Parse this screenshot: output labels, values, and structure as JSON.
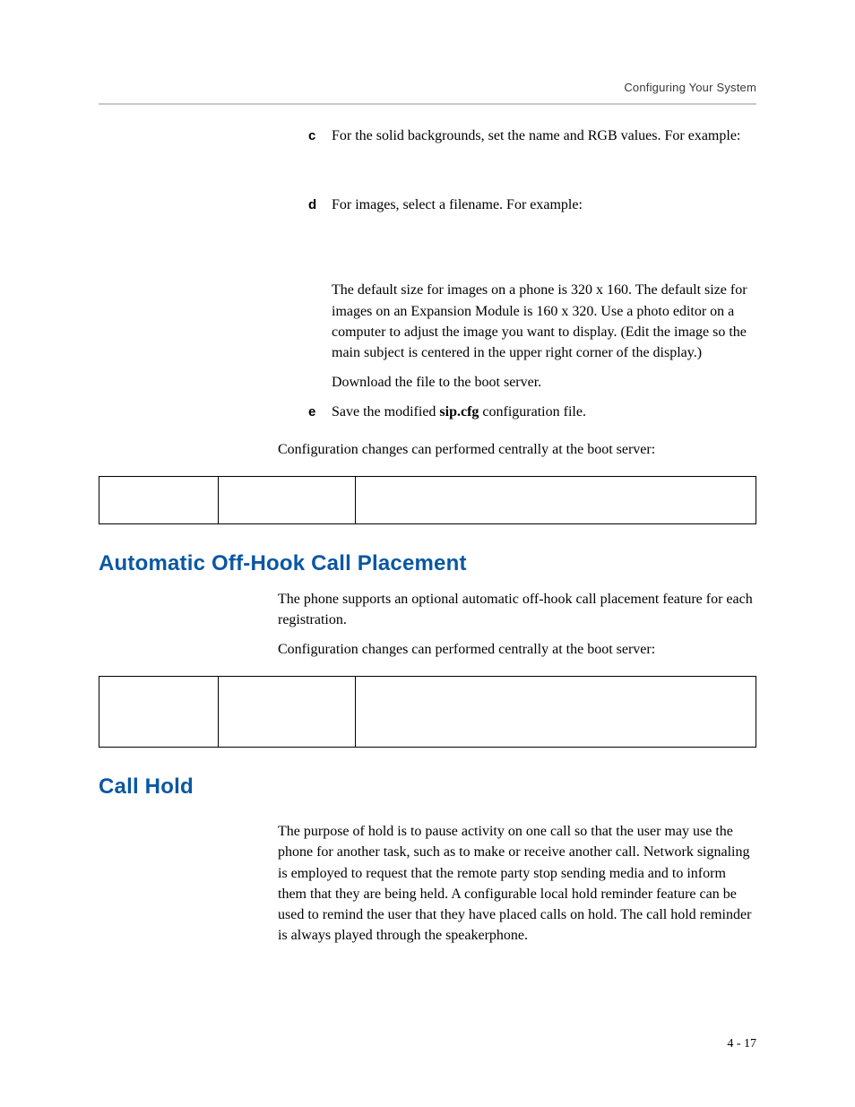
{
  "header": {
    "title": "Configuring Your System"
  },
  "steps": {
    "c": {
      "letter": "c",
      "text": "For the solid backgrounds, set the name and RGB values. For example:"
    },
    "d": {
      "letter": "d",
      "text": "For images, select a filename. For example:"
    },
    "d_detail_1": "The default size for images on a phone is 320 x 160. The default size for images on an Expansion Module is 160 x 320. Use a photo editor on a computer to adjust the image you want to display. (Edit the image so the main subject is centered in the upper right corner of the display.)",
    "d_detail_2": "Download the file to the boot server.",
    "e": {
      "letter": "e",
      "text_prefix": "Save the modified ",
      "bold": "sip.cfg",
      "text_suffix": " configuration file."
    }
  },
  "config_note": "Configuration changes can performed centrally at the boot server:",
  "section_offhook": {
    "title": "Automatic Off-Hook Call Placement",
    "body": "The phone supports an optional automatic off-hook call placement feature for each registration."
  },
  "section_callhold": {
    "title": "Call Hold",
    "body": "The purpose of hold is to pause activity on one call so that the user may use the phone for another task, such as to make or receive another call. Network signaling is employed to request that the remote party stop sending media and to inform them that they are being held. A configurable local hold reminder feature can be used to remind the user that they have placed calls on hold. The call hold reminder is always played through the speakerphone."
  },
  "footer": {
    "page": "4 - 17"
  }
}
